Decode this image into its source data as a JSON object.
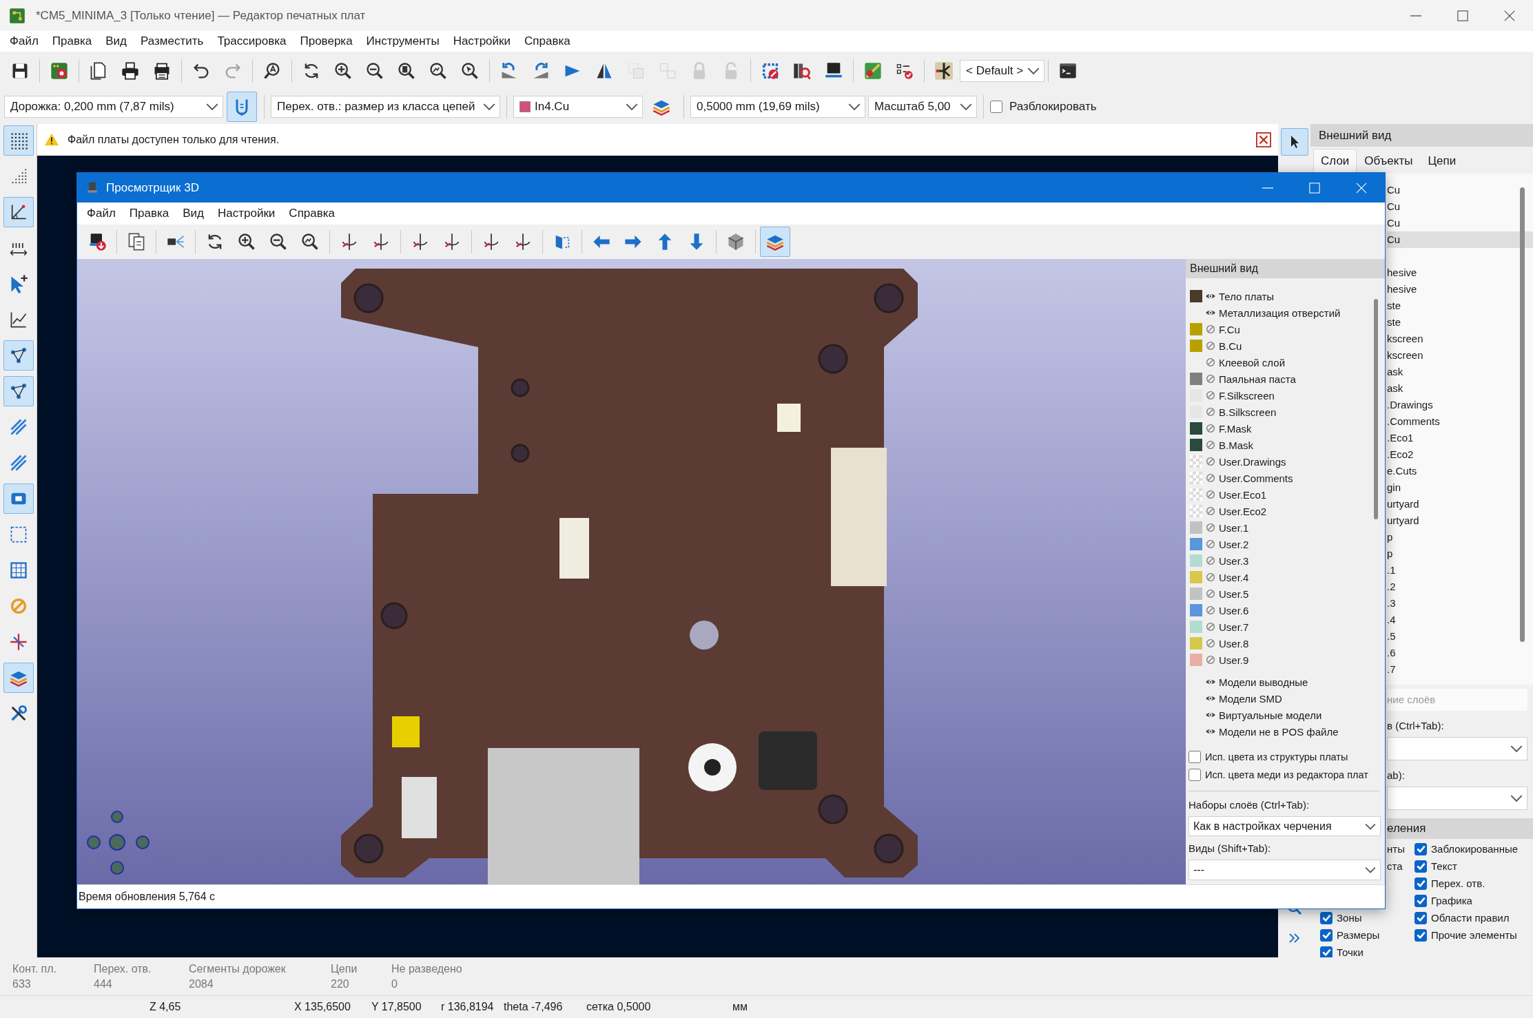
{
  "window": {
    "title": "*CM5_MINIMA_3 [Только чтение] — Редактор печатных плат"
  },
  "menu": [
    "Файл",
    "Правка",
    "Вид",
    "Разместить",
    "Трассировка",
    "Проверка",
    "Инструменты",
    "Настройки",
    "Справка"
  ],
  "main_toolbar": [
    {
      "kind": "button",
      "disabled": false
    },
    {
      "kind": "separator"
    },
    {
      "kind": "button",
      "disabled": false
    },
    {
      "kind": "separator"
    },
    {
      "kind": "button",
      "disabled": false
    },
    {
      "kind": "button",
      "disabled": false
    },
    {
      "kind": "button",
      "disabled": false
    },
    {
      "kind": "separator"
    },
    {
      "kind": "button",
      "disabled": false
    },
    {
      "kind": "button",
      "disabled": true
    },
    {
      "kind": "separator"
    },
    {
      "kind": "button",
      "disabled": false
    },
    {
      "kind": "separator"
    },
    {
      "kind": "button",
      "disabled": false
    },
    {
      "kind": "button",
      "disabled": false
    },
    {
      "kind": "button",
      "disabled": false
    },
    {
      "kind": "button",
      "disabled": false
    },
    {
      "kind": "button",
      "disabled": false
    },
    {
      "kind": "button",
      "disabled": false
    },
    {
      "kind": "separator"
    },
    {
      "kind": "button",
      "disabled": false
    },
    {
      "kind": "button",
      "disabled": false
    },
    {
      "kind": "button",
      "disabled": false
    },
    {
      "kind": "button",
      "disabled": false
    },
    {
      "kind": "button",
      "disabled": true
    },
    {
      "kind": "button",
      "disabled": true
    },
    {
      "kind": "button",
      "disabled": true
    },
    {
      "kind": "button",
      "disabled": true
    },
    {
      "kind": "separator"
    },
    {
      "kind": "button",
      "disabled": false
    },
    {
      "kind": "button",
      "disabled": false
    },
    {
      "kind": "button",
      "disabled": false
    },
    {
      "kind": "separator"
    },
    {
      "kind": "button",
      "disabled": false
    },
    {
      "kind": "button",
      "disabled": false
    },
    {
      "kind": "separator"
    },
    {
      "kind": "button",
      "disabled": false
    },
    {
      "kind": "dropdown",
      "value": "< Default >"
    },
    {
      "kind": "separator"
    },
    {
      "kind": "button",
      "disabled": false
    }
  ],
  "options_bar": {
    "track": "Дорожка: 0,200 mm (7,87 mils)",
    "track_mode_on": true,
    "via": "Перех. отв.: размер из класса цепей",
    "layer": {
      "name": "In4.Cu",
      "color": "#d4507a"
    },
    "grid": "0,5000 mm (19,69 mils)",
    "zoom": "Масштаб 5,00",
    "unlock": {
      "label": "Разблокировать",
      "checked": false
    }
  },
  "info_bar": {
    "message": "Файл платы доступен только для чтения."
  },
  "left_toolbar": [
    {
      "selected": true
    },
    {
      "selected": false
    },
    {
      "selected": true
    },
    {
      "selected": false
    },
    {
      "selected": false
    },
    {
      "selected": false
    },
    {
      "selected": true
    },
    {
      "selected": true
    },
    {
      "selected": false
    },
    {
      "selected": false
    },
    {
      "selected": true
    },
    {
      "selected": false
    },
    {
      "selected": false
    },
    {
      "selected": false
    },
    {
      "selected": false
    },
    {
      "selected": true
    },
    {
      "selected": false
    }
  ],
  "right_toolbar": [
    {
      "selected": true
    },
    {
      "selected": false
    },
    {
      "selected": false
    }
  ],
  "appearance_panel": {
    "title": "Внешний вид",
    "tabs": [
      {
        "label": "Слои",
        "selected": true
      },
      {
        "label": "Объекты",
        "selected": false
      },
      {
        "label": "Цепи",
        "selected": false
      }
    ],
    "layers": [
      {
        "text": "Cu",
        "selected": false
      },
      {
        "text": "Cu",
        "selected": false
      },
      {
        "text": "Cu",
        "selected": false
      },
      {
        "text": "Cu",
        "selected": true
      },
      {
        "text": "hesive",
        "selected": false
      },
      {
        "text": "hesive",
        "selected": false
      },
      {
        "text": "ste",
        "selected": false
      },
      {
        "text": "ste",
        "selected": false
      },
      {
        "text": "kscreen",
        "selected": false
      },
      {
        "text": "kscreen",
        "selected": false
      },
      {
        "text": "ask",
        "selected": false
      },
      {
        "text": "ask",
        "selected": false
      },
      {
        "text": ".Drawings",
        "selected": false
      },
      {
        "text": ".Comments",
        "selected": false
      },
      {
        "text": ".Eco1",
        "selected": false
      },
      {
        "text": ".Eco2",
        "selected": false
      },
      {
        "text": "e.Cuts",
        "selected": false
      },
      {
        "text": "gin",
        "selected": false
      },
      {
        "text": "urtyard",
        "selected": false
      },
      {
        "text": "urtyard",
        "selected": false
      },
      {
        "text": "p",
        "selected": false
      },
      {
        "text": "p",
        "selected": false
      },
      {
        "text": ".1",
        "selected": false
      },
      {
        "text": ".2",
        "selected": false
      },
      {
        "text": ".3",
        "selected": false
      },
      {
        "text": ".4",
        "selected": false
      },
      {
        "text": ".5",
        "selected": false
      },
      {
        "text": ".6",
        "selected": false
      },
      {
        "text": ".7",
        "selected": false
      }
    ],
    "opacity_hint": "ние слоёв",
    "presets_label": "в (Ctrl+Tab):",
    "views_label": "ab):",
    "selection_title": "еления",
    "selection_fragments": [
      "нты",
      "ста"
    ],
    "selection_left": [
      {
        "label": "Зоны",
        "checked": true
      },
      {
        "label": "Размеры",
        "checked": true
      },
      {
        "label": "Точки",
        "checked": true
      }
    ],
    "selection_right": [
      {
        "label": "Заблокированные",
        "checked": true
      },
      {
        "label": "Текст",
        "checked": true
      },
      {
        "label": "Перех. отв.",
        "checked": true
      },
      {
        "label": "Графика",
        "checked": true
      },
      {
        "label": "Области правил",
        "checked": true
      },
      {
        "label": "Прочие элементы",
        "checked": true
      }
    ]
  },
  "viewer": {
    "title": "Просмотрщик 3D",
    "menu": [
      "Файл",
      "Правка",
      "Вид",
      "Настройки",
      "Справка"
    ],
    "toolbar": [
      {
        "kind": "button",
        "selected": false
      },
      {
        "kind": "separator"
      },
      {
        "kind": "button",
        "selected": false
      },
      {
        "kind": "separator"
      },
      {
        "kind": "button",
        "selected": false
      },
      {
        "kind": "separator"
      },
      {
        "kind": "button",
        "selected": false
      },
      {
        "kind": "button",
        "selected": false
      },
      {
        "kind": "button",
        "selected": false
      },
      {
        "kind": "button",
        "selected": false
      },
      {
        "kind": "separator"
      },
      {
        "kind": "button",
        "selected": false
      },
      {
        "kind": "button",
        "selected": false
      },
      {
        "kind": "separator"
      },
      {
        "kind": "button",
        "selected": false
      },
      {
        "kind": "button",
        "selected": false
      },
      {
        "kind": "separator"
      },
      {
        "kind": "button",
        "selected": false
      },
      {
        "kind": "button",
        "selected": false
      },
      {
        "kind": "separator"
      },
      {
        "kind": "button",
        "selected": false
      },
      {
        "kind": "separator"
      },
      {
        "kind": "button",
        "selected": false
      },
      {
        "kind": "button",
        "selected": false
      },
      {
        "kind": "button",
        "selected": false
      },
      {
        "kind": "button",
        "selected": false
      },
      {
        "kind": "separator"
      },
      {
        "kind": "button",
        "selected": false
      },
      {
        "kind": "separator"
      },
      {
        "kind": "button",
        "selected": true
      }
    ],
    "appearance": {
      "title": "Внешний вид",
      "layers": [
        {
          "name": "Тело платы",
          "checker": false,
          "color": "#4a3a2a",
          "visible": true
        },
        {
          "name": "Металлизация отверстий",
          "checker": false,
          "visible": true
        },
        {
          "name": "F.Cu",
          "checker": false,
          "color": "#b8a000",
          "visible": false
        },
        {
          "name": "B.Cu",
          "checker": false,
          "color": "#b8a000",
          "visible": false
        },
        {
          "name": "Клеевой слой",
          "checker": false,
          "visible": false
        },
        {
          "name": "Паяльная паста",
          "checker": false,
          "color": "#808080",
          "visible": false
        },
        {
          "name": "F.Silkscreen",
          "checker": false,
          "color": "#e6e6e6",
          "visible": false
        },
        {
          "name": "B.Silkscreen",
          "checker": false,
          "color": "#e6e6e6",
          "visible": false
        },
        {
          "name": "F.Mask",
          "checker": false,
          "color": "#2a4a3a",
          "visible": false
        },
        {
          "name": "B.Mask",
          "checker": false,
          "color": "#2a4a3a",
          "visible": false
        },
        {
          "name": "User.Drawings",
          "checker": true,
          "visible": false
        },
        {
          "name": "User.Comments",
          "checker": true,
          "visible": false
        },
        {
          "name": "User.Eco1",
          "checker": true,
          "visible": false
        },
        {
          "name": "User.Eco2",
          "checker": true,
          "visible": false
        },
        {
          "name": "User.1",
          "checker": false,
          "color": "#c2c2c2",
          "visible": false
        },
        {
          "name": "User.2",
          "checker": false,
          "color": "#5a96dc",
          "visible": false
        },
        {
          "name": "User.3",
          "checker": false,
          "color": "#b2dcd2",
          "visible": false
        },
        {
          "name": "User.4",
          "checker": false,
          "color": "#d8c84a",
          "visible": false
        },
        {
          "name": "User.5",
          "checker": false,
          "color": "#c2c2c2",
          "visible": false
        },
        {
          "name": "User.6",
          "checker": false,
          "color": "#5a96dc",
          "visible": false
        },
        {
          "name": "User.7",
          "checker": false,
          "color": "#b2dcd2",
          "visible": false
        },
        {
          "name": "User.8",
          "checker": false,
          "color": "#d8c84a",
          "visible": false
        },
        {
          "name": "User.9",
          "checker": false,
          "color": "#e8b0a4",
          "visible": false
        }
      ],
      "models": [
        {
          "name": "Модели выводные",
          "visible": true
        },
        {
          "name": "Модели SMD",
          "visible": true
        },
        {
          "name": "Виртуальные модели",
          "visible": true
        },
        {
          "name": "Модели не в POS файле",
          "visible": true
        }
      ],
      "options": [
        {
          "label": "Исп. цвета из структуры платы",
          "checked": false
        },
        {
          "label": "Исп. цвета меди из редактора плат",
          "checked": false
        }
      ],
      "layer_presets": {
        "label": "Наборы слоёв (Ctrl+Tab):",
        "value": "Как в настройках черчения"
      },
      "viewports": {
        "label": "Виды (Shift+Tab):",
        "value": "---"
      }
    },
    "status": "Время обновления 5,764 с"
  },
  "status": {
    "stats": [
      {
        "label": "Конт. пл.",
        "value": "633"
      },
      {
        "label": "Перех. отв.",
        "value": "444"
      },
      {
        "label": "Сегменты дорожек",
        "value": "2084"
      },
      {
        "label": "Цепи",
        "value": "220"
      },
      {
        "label": "Не разведено",
        "value": "0"
      }
    ],
    "coords": [
      "Z 4,65",
      "X 135,6500",
      "Y 17,8500",
      "r 136,8194",
      "theta -7,496",
      "сетка 0,5000",
      "мм"
    ]
  }
}
